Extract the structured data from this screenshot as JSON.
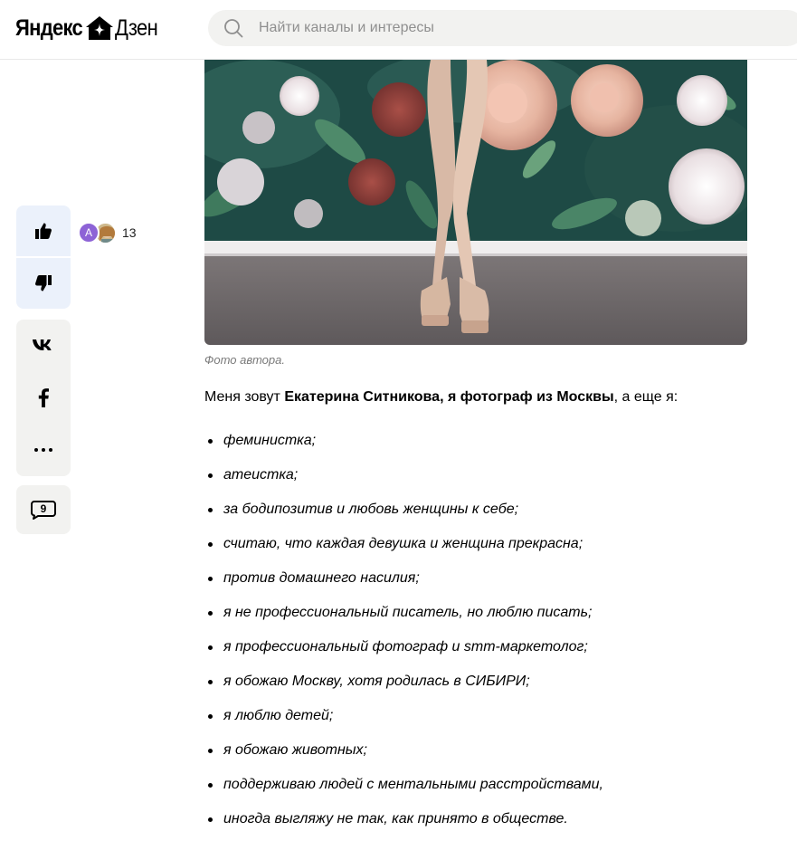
{
  "header": {
    "logo_yandex": "Яндекс",
    "logo_dzen": "Дзен",
    "search_placeholder": "Найти каналы и интересы"
  },
  "actions": {
    "likers": {
      "avatar_letter": "А",
      "like_count": "13"
    },
    "comments_count": "9",
    "icons": [
      "thumbs-up-icon",
      "thumbs-down-icon",
      "vk-icon",
      "facebook-icon",
      "more-icon",
      "comment-icon"
    ]
  },
  "article": {
    "photo_caption": "Фото автора.",
    "intro": {
      "prefix": "Меня зовут ",
      "bold": "Екатерина Ситникова, я фотограф из Москвы",
      "suffix": ", а еще я:"
    },
    "list": [
      "феминистка;",
      "атеистка;",
      "за бодипозитив и любовь женщины к себе;",
      "считаю, что каждая девушка и женщина прекрасна;",
      "против домашнего насилия;",
      "я не профессиональный писатель, но люблю писать;",
      "я профессиональный фотограф и smm-маркетолог;",
      "я обожаю Москву, хотя родилась в СИБИРИ;",
      "я люблю детей;",
      "я обожаю животных;",
      "поддерживаю людей с ментальными расстройствами,",
      "иногда выгляжу не так, как принято в обществе."
    ]
  },
  "colors": {
    "panel_bg": "#f2f2f0",
    "like_bg": "#ebf1fb",
    "avatar_purple": "#8d63d6",
    "caption_gray": "#7a7a7a"
  }
}
